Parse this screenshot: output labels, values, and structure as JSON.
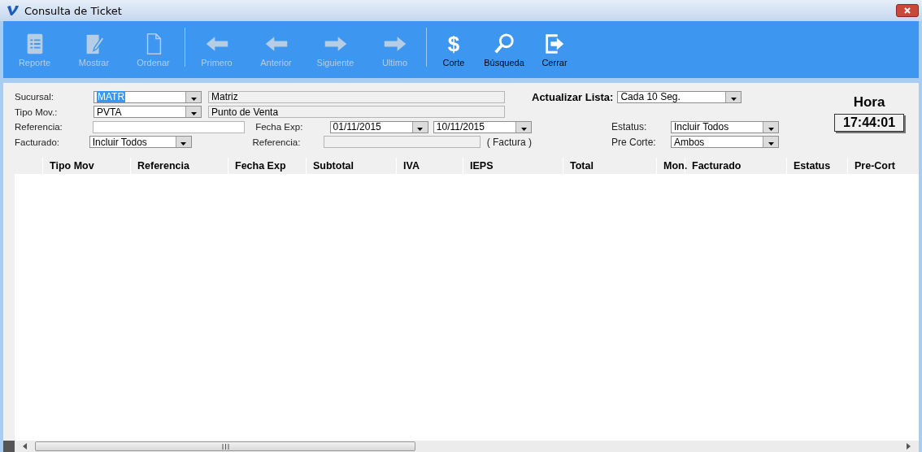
{
  "window": {
    "title": "Consulta de Ticket"
  },
  "toolbar": [
    {
      "label": "Reporte",
      "kind": "report",
      "disabled": true
    },
    {
      "label": "Mostrar",
      "kind": "edit",
      "disabled": true
    },
    {
      "label": "Ordenar",
      "kind": "page",
      "disabled": true
    },
    {
      "label": "Primero",
      "kind": "first",
      "disabled": true
    },
    {
      "label": "Anterior",
      "kind": "prev",
      "disabled": true
    },
    {
      "label": "Siguiente",
      "kind": "next",
      "disabled": true
    },
    {
      "label": "Ultimo",
      "kind": "last",
      "disabled": true
    },
    {
      "label": "Corte",
      "kind": "dollar",
      "symbol": "$",
      "disabled": false
    },
    {
      "label": "Búsqueda",
      "kind": "search",
      "disabled": false
    },
    {
      "label": "Cerrar",
      "kind": "exit",
      "disabled": false
    }
  ],
  "sucursal": {
    "label": "Sucursal:",
    "code": "MATR",
    "code_selected": true,
    "name": "Matriz"
  },
  "tipo_mov": {
    "label": "Tipo Mov.:",
    "code": "PVTA",
    "code_selected": false,
    "name": "Punto de Venta"
  },
  "referencia": {
    "label": "Referencia:"
  },
  "fecha_exp": {
    "label": "Fecha Exp:",
    "from": "01/11/2015",
    "to": "10/11/2015"
  },
  "facturado": {
    "label": "Facturado:",
    "value": "Incluir Todos"
  },
  "referencia_factura": {
    "label": "Referencia:",
    "note": "( Factura )"
  },
  "actualizar_lista": {
    "label": "Actualizar Lista:",
    "value": "Cada 10 Seg."
  },
  "estatus": {
    "label": "Estatus:",
    "value": "Incluir Todos"
  },
  "pre_corte": {
    "label": "Pre Corte:",
    "value": "Ambos"
  },
  "clock": {
    "label": "Hora",
    "time": "17:44:01"
  },
  "table": {
    "columns": [
      "Tipo Mov",
      "Referencia",
      "Fecha Exp",
      "Subtotal",
      "IVA",
      "IEPS",
      "Total",
      "Mon.",
      "Facturado",
      "Estatus",
      "Pre-Cort"
    ]
  }
}
